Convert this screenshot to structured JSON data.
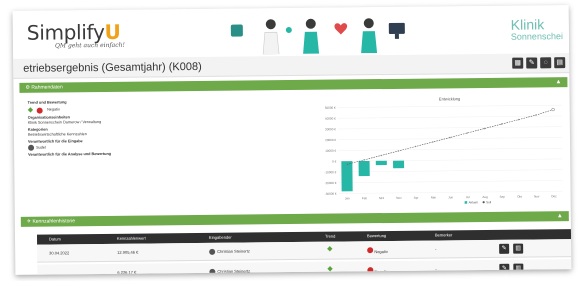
{
  "header": {
    "logo_text": "Simplify",
    "logo_accent": "U",
    "slogan": "QM geht auch einfach!",
    "clinic_line1": "Klinik",
    "clinic_line2": "Sonnenschei"
  },
  "page": {
    "title": "etriebsergebnis (Gesamtjahr) (K008)",
    "toolbar_icons": [
      "grid-icon",
      "edit-icon",
      "chat-icon",
      "print-icon"
    ]
  },
  "rahmendaten": {
    "section_label": "Rahmendaten",
    "trend_label": "Trend und Bewertung",
    "rating": "Negativ",
    "org_label": "Organisationseinheiten",
    "org_value": "Klinik Sonnenschein Damerow / Verwaltung",
    "category_label": "Kategorien",
    "category_value": "Betriebswirtschaftliche Kennzahlen",
    "input_resp_label": "Verantwortlich für die Eingabe",
    "input_resp_value": "Sudel",
    "analysis_resp_label": "Verantwortlich für die Analyse und Bewertung"
  },
  "chart_data": {
    "type": "bar",
    "title": "Entwicklung",
    "categories": [
      "Jan",
      "Feb",
      "Mrz",
      "Nov",
      "Apr",
      "Mai",
      "Jun",
      "Jul",
      "Aug",
      "Sep",
      "Okt",
      "Nov",
      "Dez"
    ],
    "series": [
      {
        "name": "Aktuell",
        "values": [
          -28000,
          -14000,
          -4000,
          -7000,
          null,
          null,
          null,
          null,
          null,
          null,
          null,
          null,
          null
        ]
      },
      {
        "name": "Soll",
        "values": [
          -3000,
          1000,
          5000,
          9000,
          13000,
          17000,
          21000,
          25000,
          29000,
          33000,
          37000,
          41000,
          46000
        ]
      }
    ],
    "yticks": [
      "50000 €",
      "40000 €",
      "30000 €",
      "20000 €",
      "10000 €",
      "0 €",
      "-10000 €",
      "-20000 €",
      "-30000 €"
    ],
    "ylim": [
      -30000,
      50000
    ],
    "legend": "bottom-right",
    "colors": {
      "bar": "#26b7a6",
      "target": "#555555"
    }
  },
  "kennzahlenbar": {
    "section_label": "Kennzahlenhistorie"
  },
  "table": {
    "headers": [
      "Datum",
      "Kennzahlenwert",
      "Eingabender",
      "Trend",
      "Bewertung",
      "Bemerker"
    ],
    "rows": [
      {
        "date": "30.04.2022",
        "value": "12.905,46 €",
        "user": "Christian Steinertz",
        "rating": "Negativ",
        "note": "-"
      },
      {
        "date": "",
        "value": "6.226,17 €",
        "user": "Christian Steinertz",
        "rating": "Negativ",
        "note": "-"
      }
    ]
  }
}
